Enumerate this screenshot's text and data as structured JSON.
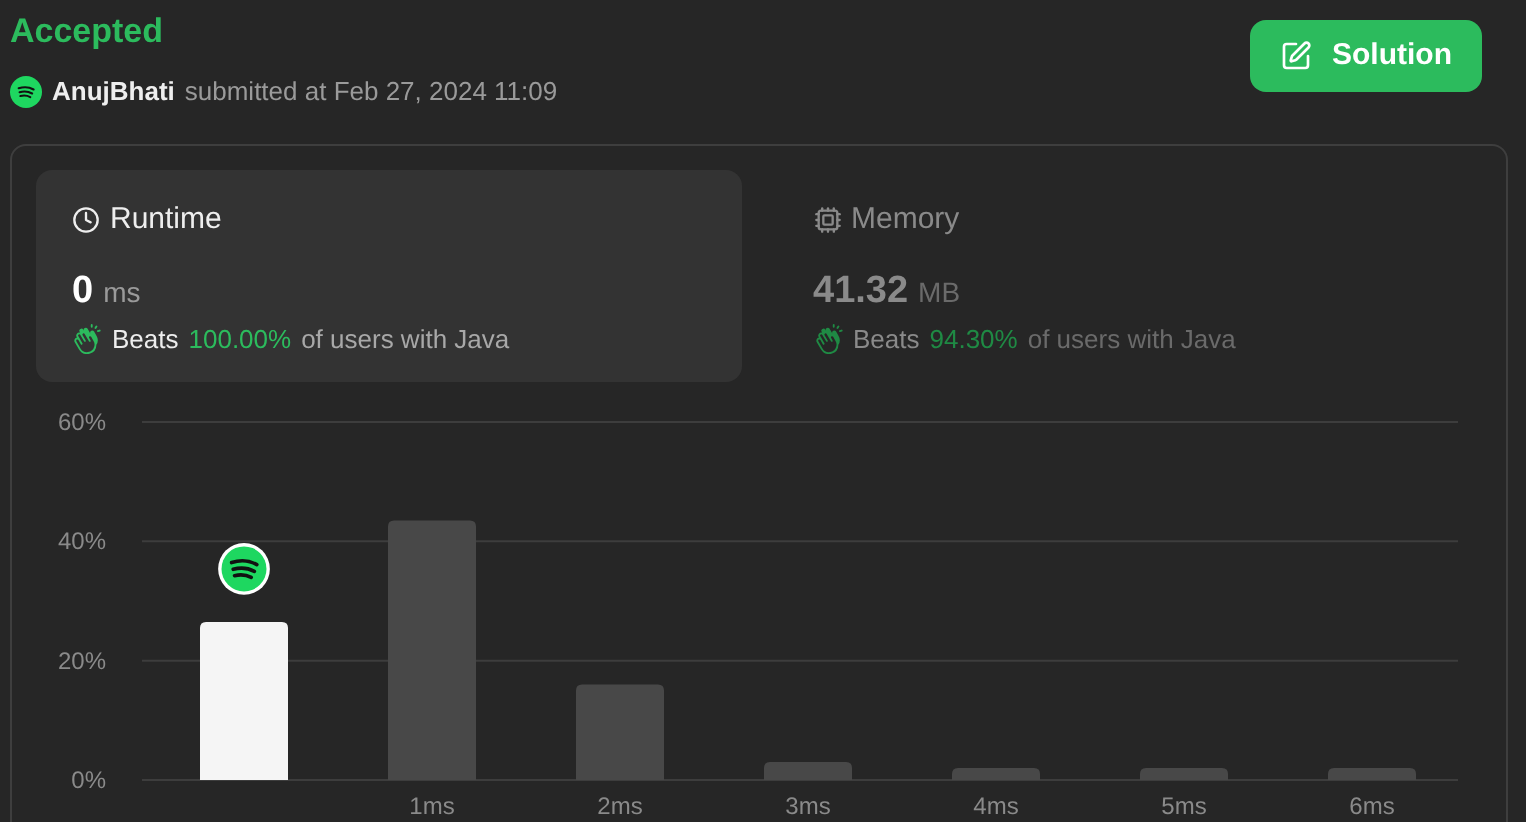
{
  "status": "Accepted",
  "submission": {
    "user": "AnujBhati",
    "text": "submitted at Feb 27, 2024 11:09"
  },
  "solution_button": "Solution",
  "metrics": [
    {
      "label": "Runtime",
      "kind": "runtime",
      "selected": true,
      "value": "0",
      "unit": "ms",
      "beats_label": "Beats",
      "beats": "100.00%",
      "beats_suffix": "of users with Java"
    },
    {
      "label": "Memory",
      "kind": "memory",
      "selected": false,
      "value": "41.32",
      "unit": "MB",
      "beats_label": "Beats",
      "beats": "94.30%",
      "beats_suffix": "of users with Java"
    }
  ],
  "chart": {
    "chart_data": {
      "type": "bar",
      "categories": [
        null,
        "1ms",
        "2ms",
        "3ms",
        "4ms",
        "5ms",
        "6ms"
      ],
      "values": [
        26.5,
        43.5,
        16,
        3,
        2,
        2,
        2
      ],
      "ylim": [
        0,
        60
      ],
      "yticks": [
        {
          "value": 0,
          "label": "0%"
        },
        {
          "value": 20,
          "label": "20%"
        },
        {
          "value": 40,
          "label": "40%"
        },
        {
          "value": 60,
          "label": "60%"
        }
      ]
    },
    "bars": [
      {
        "selected": true
      },
      {
        "selected": false
      },
      {
        "selected": false
      },
      {
        "selected": false
      },
      {
        "selected": false
      },
      {
        "selected": false
      },
      {
        "selected": false
      }
    ]
  }
}
